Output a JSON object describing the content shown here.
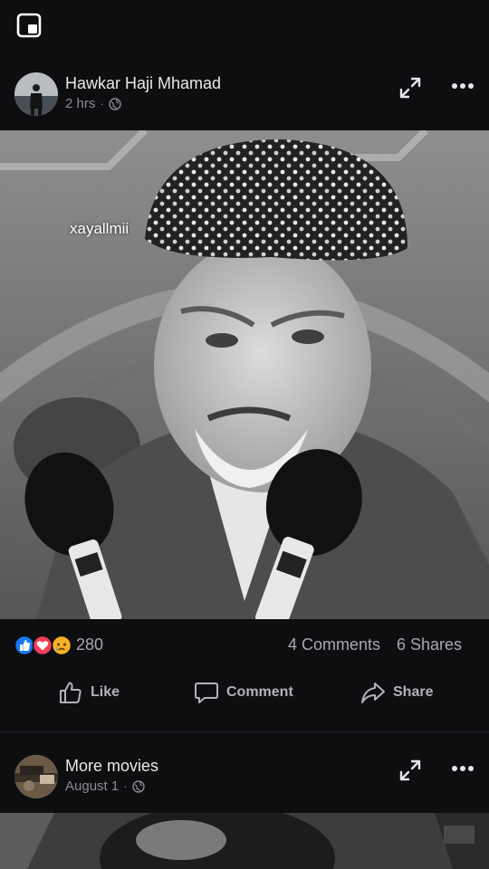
{
  "icons": {
    "pip": "picture-in-picture-icon",
    "globe": "globe-icon",
    "expand": "expand-icon",
    "more": "more-options-icon",
    "like": "thumbs-up-icon",
    "comment": "speech-bubble-icon",
    "share": "share-arrow-icon"
  },
  "colors": {
    "background": "#0e0e11",
    "like_blue": "#1877f2",
    "love_red": "#f33e58",
    "sad_yellow": "#f7b125"
  },
  "post1": {
    "author": "Hawkar Haji Mhamad",
    "time": "2 hrs",
    "separator": "·",
    "video": {
      "watermark": "xayallmii"
    },
    "reactions": {
      "types": [
        "like",
        "love",
        "sad"
      ],
      "count": "280"
    },
    "comments_label": "4 Comments",
    "shares_label": "6 Shares",
    "actions": {
      "like": "Like",
      "comment": "Comment",
      "share": "Share"
    }
  },
  "post2": {
    "author": "More movies",
    "time": "August 1",
    "separator": "·"
  }
}
